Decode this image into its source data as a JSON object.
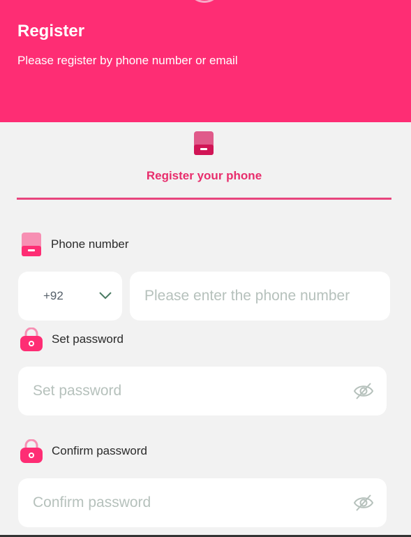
{
  "header": {
    "title": "Register",
    "subtitle": "Please register by phone number or email",
    "background": "#fe2d74"
  },
  "tab": {
    "label": "Register your phone",
    "icon": "phone-icon",
    "accent": "#e82d6c"
  },
  "phone": {
    "label": "Phone number",
    "icon": "phone-icon",
    "country_code": "+92",
    "placeholder": "Please enter the phone number",
    "value": ""
  },
  "password": {
    "label": "Set password",
    "icon": "lock-icon",
    "placeholder": "Set password",
    "value": "",
    "toggle_icon": "eye-off-icon"
  },
  "confirm_password": {
    "label": "Confirm password",
    "icon": "lock-icon",
    "placeholder": "Confirm password",
    "value": "",
    "toggle_icon": "eye-off-icon"
  }
}
